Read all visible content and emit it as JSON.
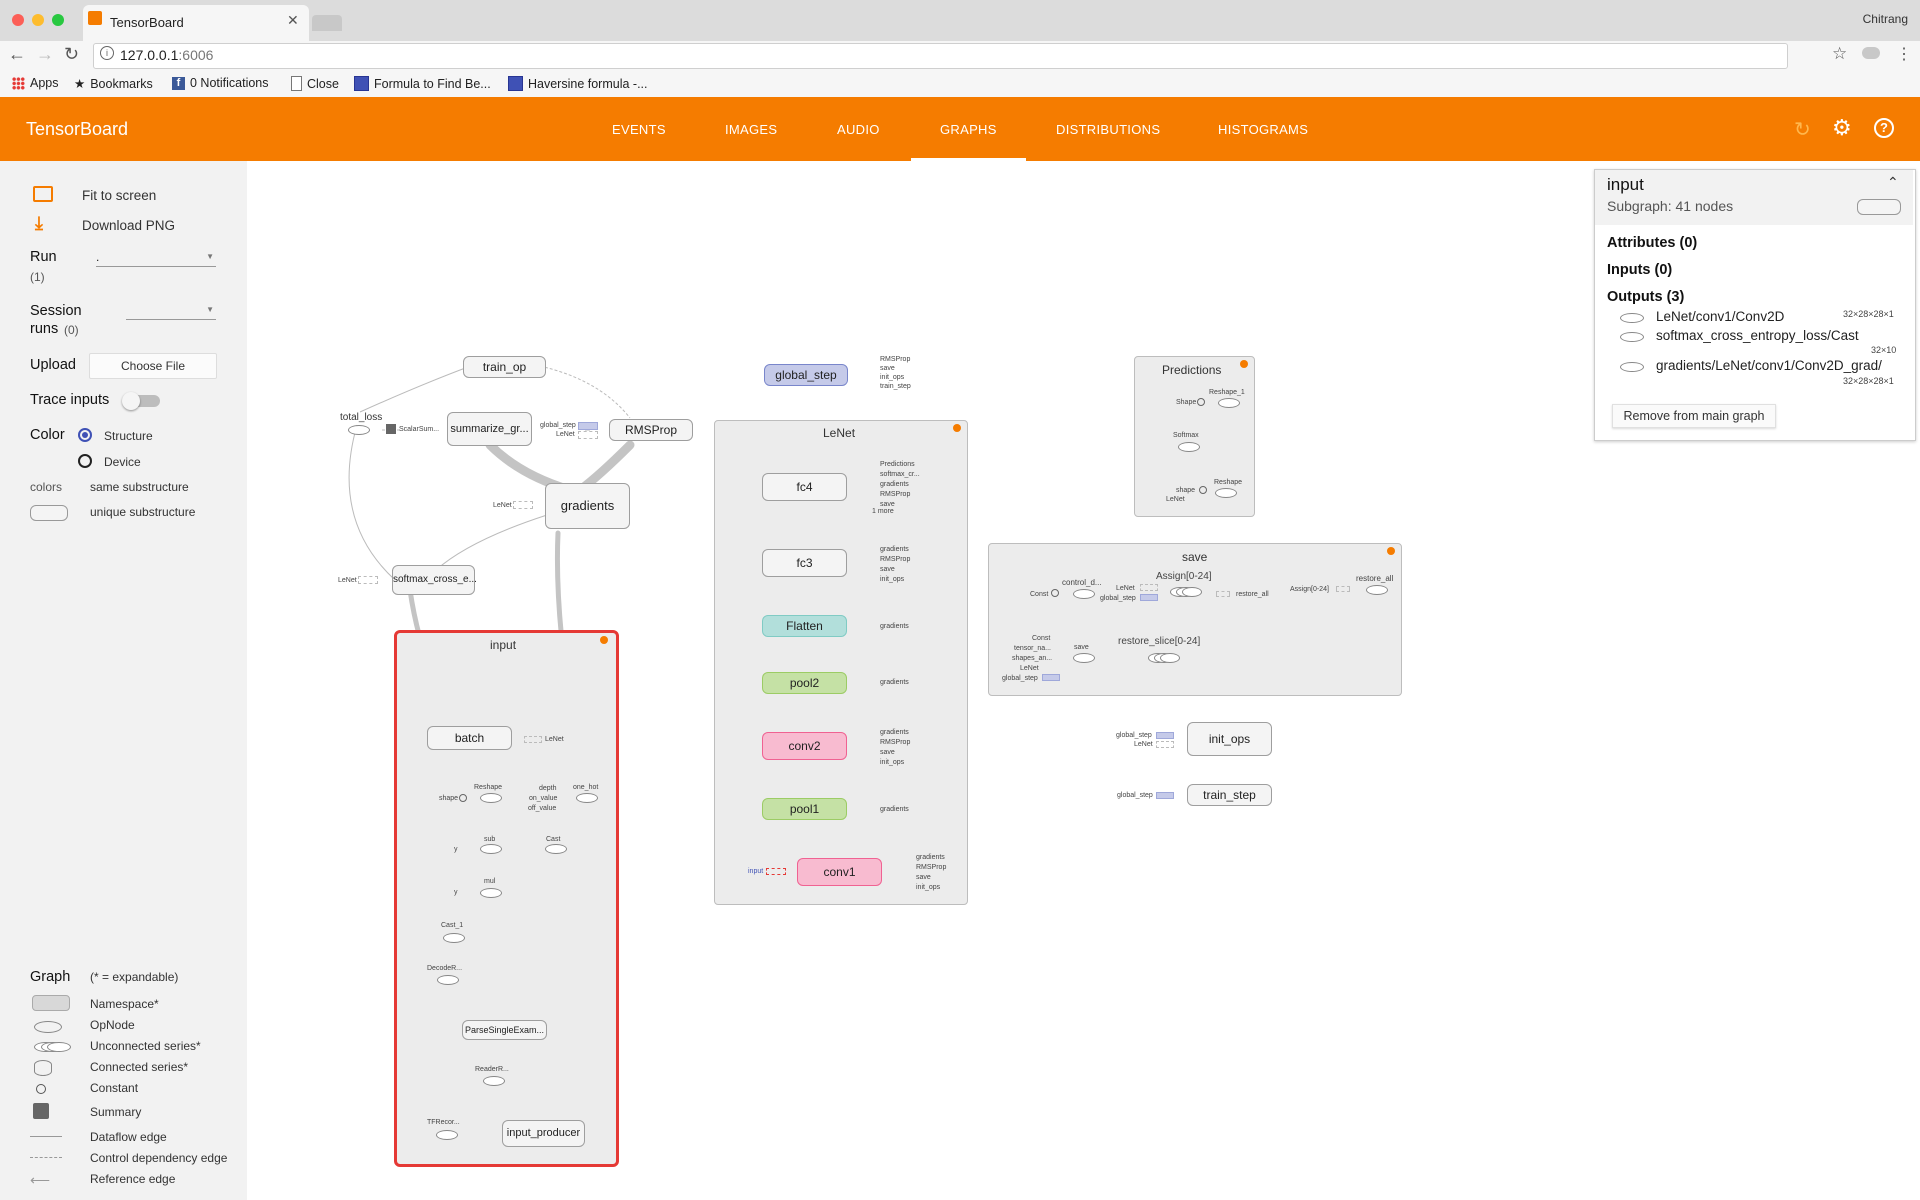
{
  "browser": {
    "tab_title": "TensorBoard",
    "profile_name": "Chitrang",
    "url_host": "127.0.0.1",
    "url_port": ":6006",
    "bookmarks": [
      {
        "label": "Apps",
        "icon": "apps-grid-icon"
      },
      {
        "label": "Bookmarks",
        "icon": "star-icon"
      },
      {
        "label": "0 Notifications",
        "icon": "facebook-icon"
      },
      {
        "label": "Close",
        "icon": "page-icon"
      },
      {
        "label": "Formula to Find Be...",
        "icon": "table-icon"
      },
      {
        "label": "Haversine formula -...",
        "icon": "table-icon"
      }
    ]
  },
  "header": {
    "title": "TensorBoard",
    "tabs": [
      "EVENTS",
      "IMAGES",
      "AUDIO",
      "GRAPHS",
      "DISTRIBUTIONS",
      "HISTOGRAMS"
    ],
    "active_tab": "GRAPHS",
    "accent_color": "#f57c00"
  },
  "sidebar": {
    "fit_to_screen": "Fit to screen",
    "download_png": "Download PNG",
    "run_label": "Run",
    "run_count": "(1)",
    "run_value": ".",
    "session_runs_label": "Session runs",
    "session_runs_count": "(0)",
    "upload_label": "Upload",
    "choose_file": "Choose File",
    "trace_inputs": "Trace inputs",
    "color_label": "Color",
    "color_structure": "Structure",
    "color_device": "Device",
    "colors_label": "colors",
    "same_substructure": "same substructure",
    "unique_substructure": "unique substructure",
    "graph_label": "Graph",
    "graph_note": "(* = expandable)",
    "legend": [
      "Namespace*",
      "OpNode",
      "Unconnected series*",
      "Connected series*",
      "Constant",
      "Summary",
      "Dataflow edge",
      "Control dependency edge",
      "Reference edge"
    ]
  },
  "graph": {
    "top": {
      "train_op": "train_op",
      "total_loss": "total_loss",
      "scalar_summary": "ScalarSum...",
      "summarize": "summarize_gr...",
      "rmsprop": "RMSProp",
      "global_step_in": "global_step",
      "lenet_in": "LeNet",
      "gradients": "gradients",
      "softmax": "softmax_cross_e...",
      "lenet_small": "LeNet",
      "lenet_small2": "LeNet"
    },
    "input_box": {
      "title": "input",
      "batch": "batch",
      "lenet_out": "LeNet",
      "reshape": "Reshape",
      "shape": "shape",
      "one_hot": "one_hot",
      "depth": "depth",
      "on_value": "on_value",
      "off_value": "off_value",
      "sub": "sub",
      "y1": "y",
      "cast": "Cast",
      "mul": "mul",
      "y2": "y",
      "cast_1": "Cast_1",
      "decode": "DecodeR...",
      "parse": "ParseSingleExam...",
      "reader": "ReaderR...",
      "tfrecord": "TFRecor...",
      "input_producer": "input_producer"
    },
    "global_step_node": {
      "label": "global_step",
      "outs": [
        "RMSProp",
        "save",
        "init_ops",
        "train_step"
      ]
    },
    "lenet_box": {
      "title": "LeNet",
      "fc4": "fc4",
      "fc4_outs": [
        "Predictions",
        "softmax_cr...",
        "gradients",
        "RMSProp",
        "save",
        "1 more"
      ],
      "fc3": "fc3",
      "fc3_outs": [
        "gradients",
        "RMSProp",
        "save",
        "init_ops"
      ],
      "flatten": "Flatten",
      "flatten_outs": [
        "gradients"
      ],
      "pool2": "pool2",
      "pool2_outs": [
        "gradients"
      ],
      "conv2": "conv2",
      "conv2_outs": [
        "gradients",
        "RMSProp",
        "save",
        "init_ops"
      ],
      "pool1": "pool1",
      "pool1_outs": [
        "gradients"
      ],
      "conv1": "conv1",
      "conv1_in": "input",
      "conv1_outs": [
        "gradients",
        "RMSProp",
        "save",
        "init_ops"
      ],
      "colors": {
        "flatten": "#b2dfdb",
        "pool": "#c5e1a5",
        "conv": "#f8bbd0",
        "global": "#c5cae9"
      }
    },
    "predictions_box": {
      "title": "Predictions",
      "reshape_1": "Reshape_1",
      "shape": "Shape",
      "softmax": "Softmax",
      "reshape": "Reshape",
      "shape2": "shape",
      "lenet": "LeNet"
    },
    "save_box": {
      "title": "save",
      "control_d": "control_d...",
      "const": "Const",
      "lenet": "LeNet",
      "global_step": "global_step",
      "assign": "Assign[0-24]",
      "restore_all_out": "restore_all",
      "assign_in": "Assign[0-24]",
      "restore_all": "restore_all",
      "save": "save",
      "const2": "Const",
      "tensor_na": "tensor_na...",
      "shapes_an": "shapes_an...",
      "lenet2": "LeNet",
      "global_step2": "global_step",
      "restore_slice": "restore_slice[0-24]"
    },
    "init_ops": {
      "label": "init_ops",
      "in1": "global_step",
      "in2": "LeNet"
    },
    "train_step": {
      "label": "train_step",
      "in1": "global_step"
    }
  },
  "info_card": {
    "title": "input",
    "subtitle": "Subgraph: 41 nodes",
    "attributes": "Attributes (0)",
    "inputs": "Inputs (0)",
    "outputs": "Outputs (3)",
    "output_items": [
      {
        "name": "LeNet/conv1/Conv2D",
        "shape": "32×28×28×1"
      },
      {
        "name": "softmax_cross_entropy_loss/Cast",
        "shape": "32×10"
      },
      {
        "name": "gradients/LeNet/conv1/Conv2D_grad/",
        "shape": "32×28×28×1"
      }
    ],
    "remove_button": "Remove from main graph"
  }
}
